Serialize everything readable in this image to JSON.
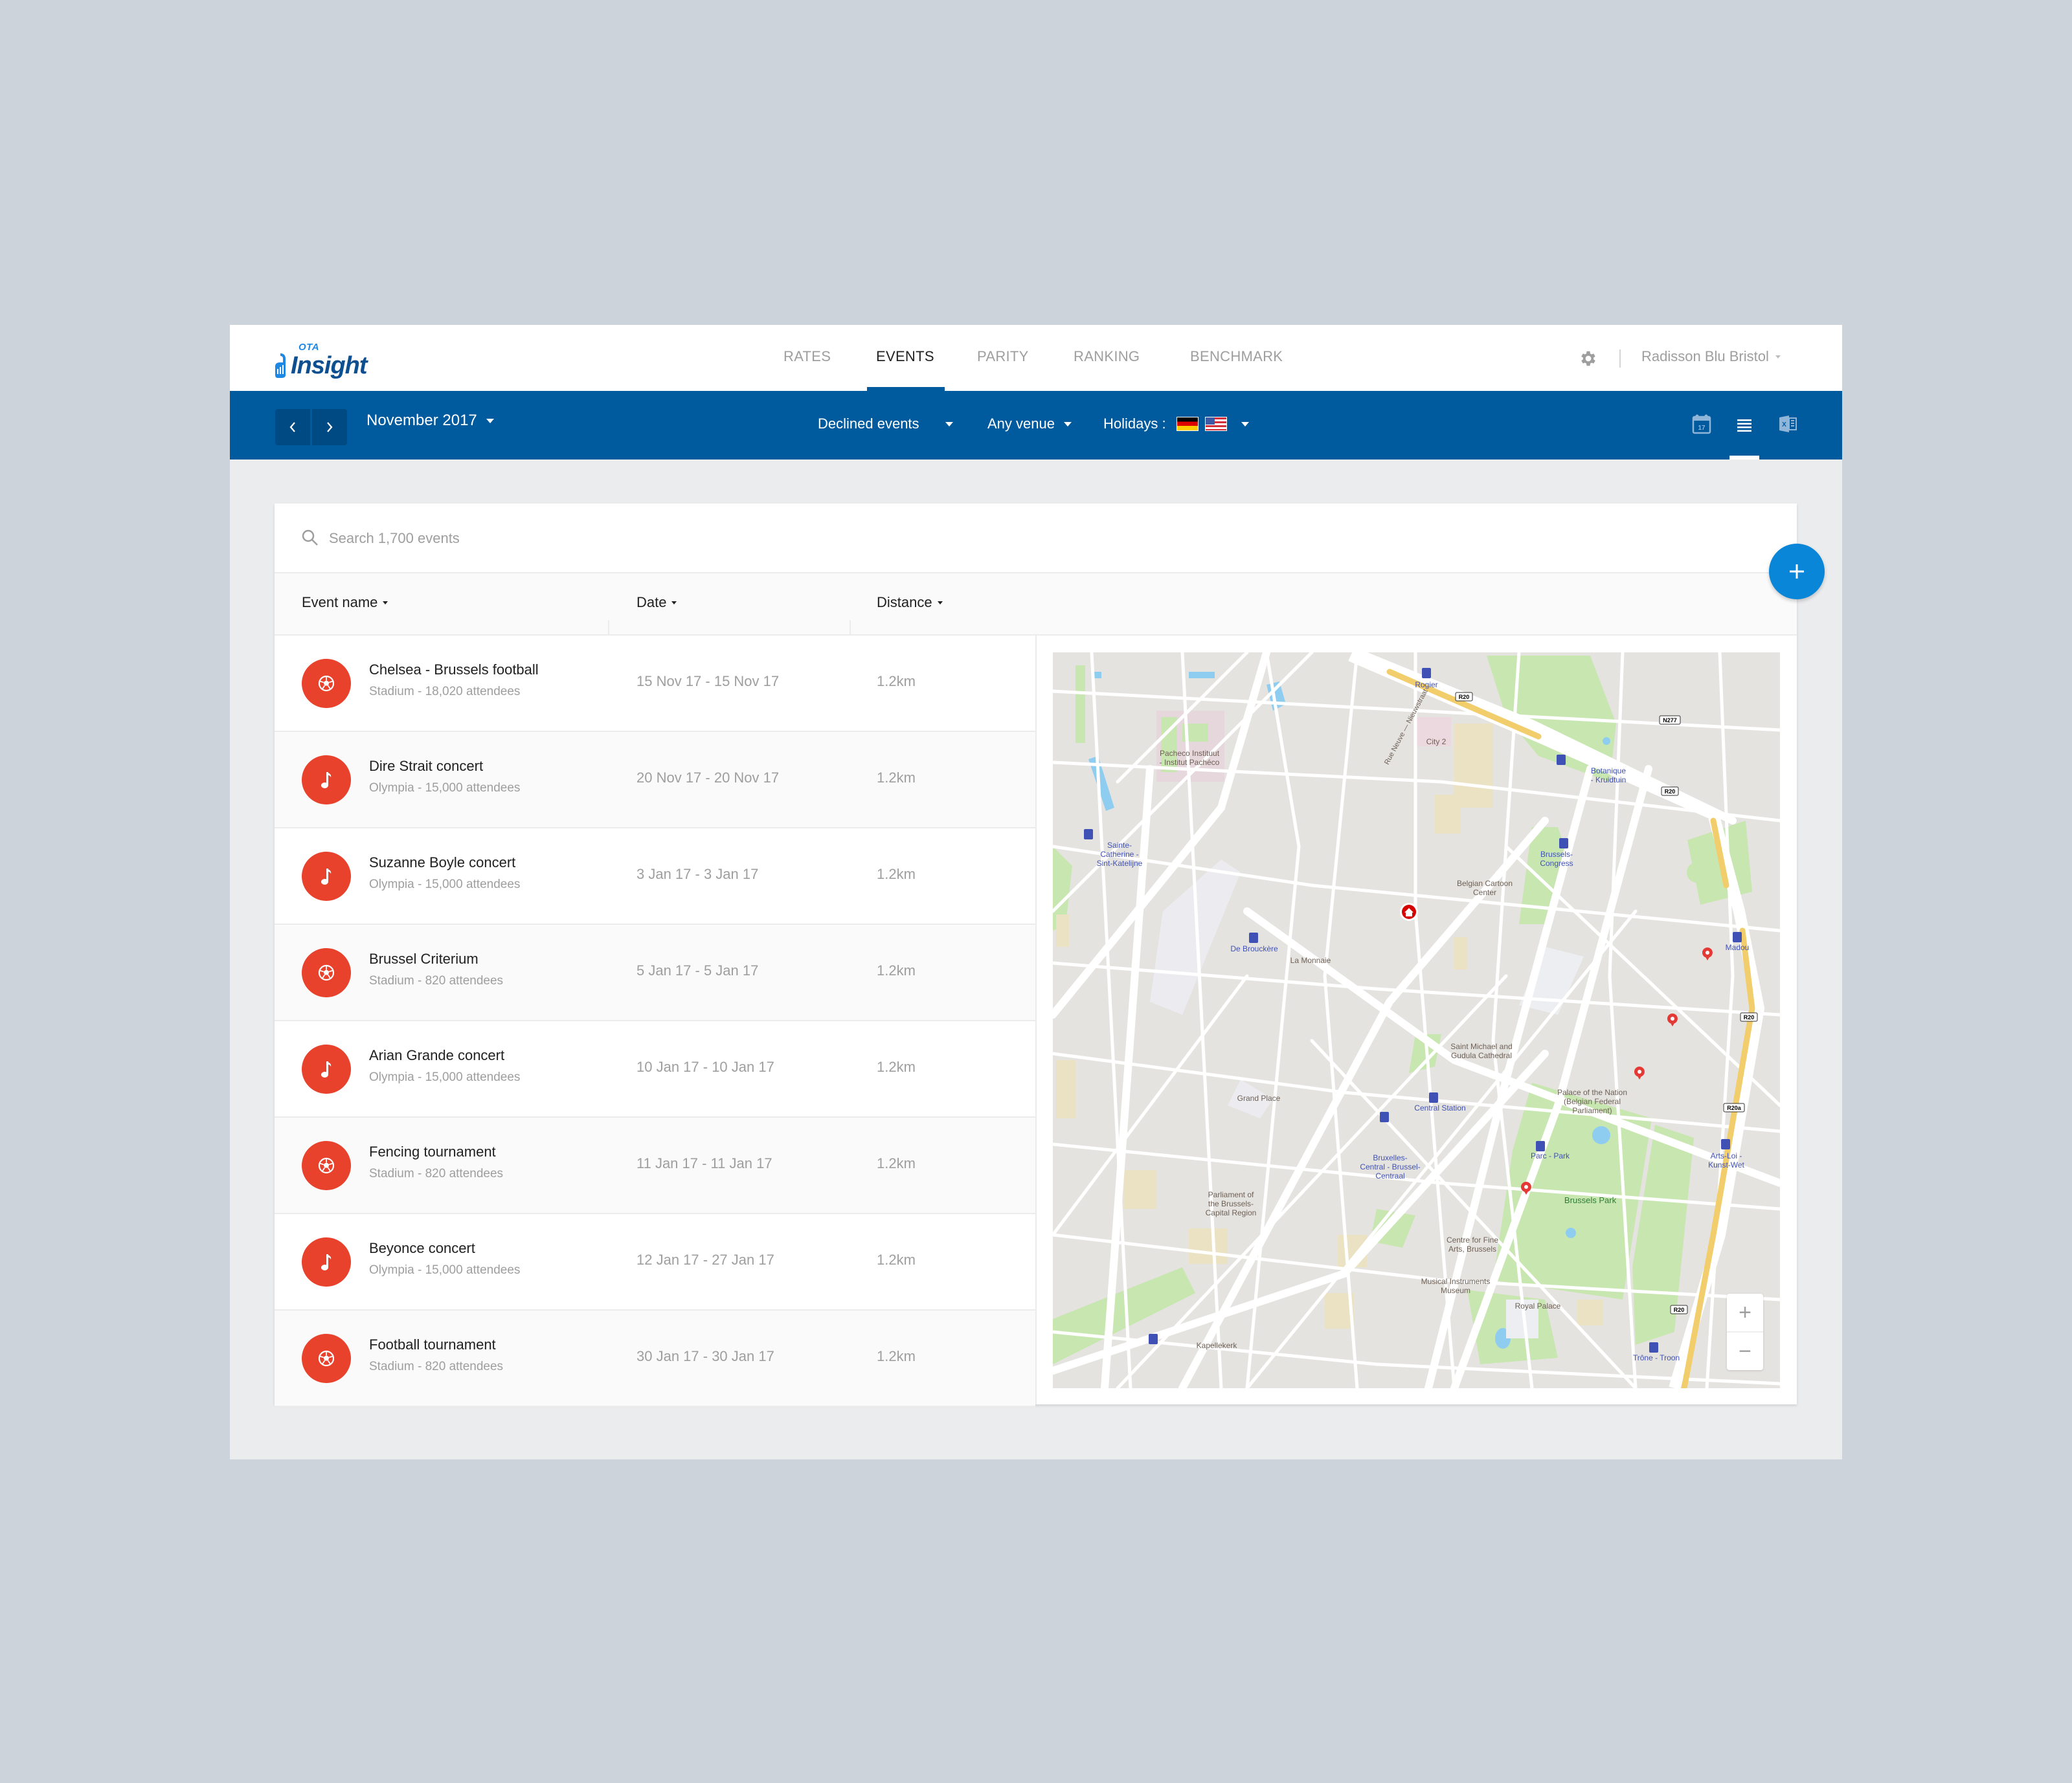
{
  "app": {
    "logo_small": "OTA",
    "logo_word": "Insight",
    "nav": [
      {
        "label": "RATES",
        "active": false
      },
      {
        "label": "EVENTS",
        "active": true
      },
      {
        "label": "PARITY",
        "active": false
      },
      {
        "label": "RANKING",
        "active": false
      },
      {
        "label": "BENCHMARK",
        "active": false
      }
    ],
    "settings_icon": "gear-icon",
    "hotel": "Radisson Blu Bristol"
  },
  "toolbar": {
    "prev_icon": "chevron-left-icon",
    "next_icon": "chevron-right-icon",
    "month": "November 2017",
    "event_filter": "Declined events",
    "venue_filter": "Any venue",
    "holidays_label": "Holidays :",
    "holiday_flags": [
      "Germany",
      "United States"
    ],
    "views": [
      {
        "icon": "calendar-icon",
        "day": "17",
        "active": false
      },
      {
        "icon": "list-icon",
        "active": true
      },
      {
        "icon": "excel-icon",
        "active": false
      }
    ],
    "colors": {
      "bar": "#005a9e",
      "button": "#004a84"
    }
  },
  "search": {
    "placeholder": "Search 1,700 events",
    "value": ""
  },
  "table": {
    "columns": [
      "Event name",
      "Date",
      "Distance"
    ],
    "rows": [
      {
        "type": "football",
        "name": "Chelsea - Brussels football",
        "sub": "Stadium - 18,020 attendees",
        "date": "15 Nov 17 - 15 Nov 17",
        "distance": "1.2km"
      },
      {
        "type": "music",
        "name": "Dire Strait concert",
        "sub": "Olympia - 15,000 attendees",
        "date": "20 Nov 17 - 20 Nov 17",
        "distance": "1.2km"
      },
      {
        "type": "music",
        "name": "Suzanne Boyle concert",
        "sub": "Olympia - 15,000 attendees",
        "date": "3 Jan 17 - 3 Jan 17",
        "distance": "1.2km"
      },
      {
        "type": "football",
        "name": "Brussel Criterium",
        "sub": "Stadium - 820 attendees",
        "date": "5 Jan 17 - 5 Jan 17",
        "distance": "1.2km"
      },
      {
        "type": "music",
        "name": "Arian Grande concert",
        "sub": "Olympia - 15,000 attendees",
        "date": "10 Jan 17 - 10 Jan 17",
        "distance": "1.2km"
      },
      {
        "type": "football",
        "name": "Fencing tournament",
        "sub": "Stadium - 820 attendees",
        "date": "11 Jan 17 - 11 Jan 17",
        "distance": "1.2km"
      },
      {
        "type": "music",
        "name": "Beyonce concert",
        "sub": "Olympia - 15,000 attendees",
        "date": "12 Jan 17 - 27 Jan 17",
        "distance": "1.2km"
      },
      {
        "type": "football",
        "name": "Football tournament",
        "sub": "Stadium - 820 attendees",
        "date": "30 Jan 17 - 30 Jan 17",
        "distance": "1.2km"
      }
    ],
    "event_icon_color": "#e8412c"
  },
  "map": {
    "labels": {
      "pacheco": "Pacheco Instituut\n- Institut Pachéco",
      "sainte_catherine": "Sainte-\nCatherine -\nSint-Katelijne",
      "rue_neuve": "Rue Neuve — Nieuwstraat",
      "rogier": "Rogier",
      "city2": "City 2",
      "botanique": "Botanique\n- Kruidtuin",
      "congress": "Brussels-\nCongress",
      "cartoon": "Belgian Cartoon\nCenter",
      "madou": "Madou",
      "debrouckere": "De Brouckère",
      "monnaie": "La Monnaie",
      "grand_place": "Grand Place",
      "cathedral": "Saint Michael and\nGudula Cathedral",
      "central_station": "Central Station",
      "bruxelles_central": "Bruxelles-\nCentral - Brussel-\nCentraal",
      "palace_nation": "Palace of the Nation\n(Belgian Federal\nParliament)",
      "parc": "Parc - Park",
      "arts_loi": "Arts-Loi -\nKunst-Wet",
      "brussels_park": "Brussels Park",
      "parliament_region": "Parliament of\nthe Brussels-\nCapital Region",
      "fine_arts": "Centre for Fine\nArts, Brussels",
      "mim": "Musical Instruments\nMuseum",
      "royal_palace": "Royal Palace",
      "kapellekerk": "Kapellekerk",
      "trone": "Trône - Troon"
    },
    "road_shields": [
      "R20",
      "R20",
      "N277",
      "R20",
      "R20a",
      "R20"
    ],
    "hotel_marker": "home-marker",
    "event_marker_count": 4,
    "zoom_in": "+",
    "zoom_out": "−"
  },
  "fab": {
    "icon": "plus-icon",
    "color": "#0a86d8"
  }
}
